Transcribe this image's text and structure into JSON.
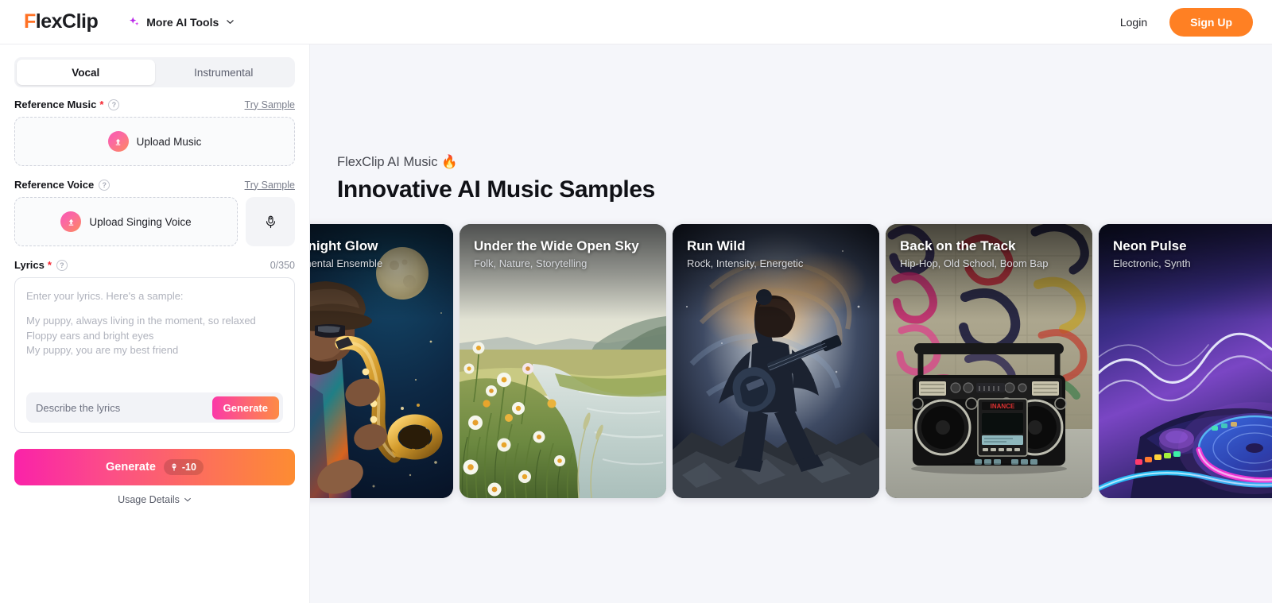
{
  "header": {
    "logo_f": "F",
    "logo_rest": "lexClip",
    "more_tools": "More AI Tools",
    "login": "Login",
    "signup": "Sign Up"
  },
  "sidebar": {
    "tabs": [
      {
        "label": "Vocal",
        "active": true
      },
      {
        "label": "Instrumental",
        "active": false
      }
    ],
    "reference_music": {
      "label": "Reference Music",
      "required": "*",
      "try_sample": "Try Sample",
      "upload_label": "Upload Music"
    },
    "reference_voice": {
      "label": "Reference Voice",
      "try_sample": "Try Sample",
      "upload_label": "Upload Singing Voice"
    },
    "lyrics": {
      "label": "Lyrics",
      "required": "*",
      "counter": "0/350",
      "placeholder_intro": "Enter your lyrics. Here's a sample:",
      "placeholder_line1": "My puppy, always living in the moment, so relaxed",
      "placeholder_line2": "Floppy ears and bright eyes",
      "placeholder_line3": "My puppy, you are my best friend",
      "describe_placeholder": "Describe the lyrics",
      "generate_label": "Generate"
    },
    "generate": {
      "label": "Generate",
      "credits": "-10"
    },
    "usage_details": "Usage Details"
  },
  "main": {
    "eyebrow": "FlexClip AI Music 🔥",
    "headline": "Innovative AI Music Samples",
    "cards": [
      {
        "title": "the Midnight Glow",
        "subtitle": "zz, Instrumental Ensemble",
        "art": "saxophone-night"
      },
      {
        "title": "Under the Wide Open Sky",
        "subtitle": "Folk, Nature, Storytelling",
        "art": "river-meadow"
      },
      {
        "title": "Run Wild",
        "subtitle": "Rock, Intensity, Energetic",
        "art": "guitarist-nebula"
      },
      {
        "title": "Back on the Track",
        "subtitle": "Hip-Hop, Old School, Boom Bap",
        "art": "boombox-graffiti"
      },
      {
        "title": "Neon Pulse",
        "subtitle": "Electronic, Synth",
        "art": "neon-turntable"
      }
    ]
  },
  "colors": {
    "brand_orange": "#ff8023",
    "accent_pink": "#fa22a9",
    "required_red": "#f5222d",
    "main_bg": "#f5f6fa"
  }
}
